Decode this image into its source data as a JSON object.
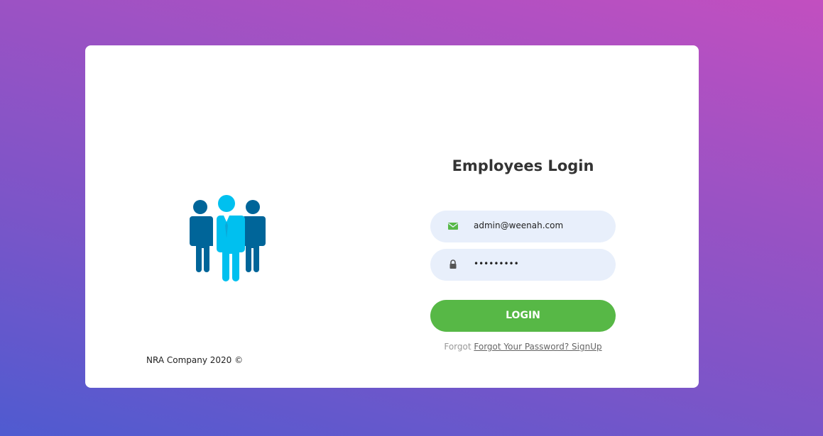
{
  "footer": {
    "copyright": "NRA Company 2020 ©"
  },
  "login": {
    "title": "Employees Login",
    "email_value": "admin@weenah.com",
    "password_value": "•••••••••",
    "button_label": "LOGIN",
    "forgot_prefix": "Forgot",
    "forgot_link": "Forgot Your Password? SignUp"
  },
  "icons": {
    "illustration": "employees-group-icon",
    "email": "envelope-icon",
    "password": "lock-icon"
  },
  "colors": {
    "accent": "#57b846",
    "input_bg": "#e8effb",
    "people_dark": "#006599",
    "people_light": "#00c0ef"
  }
}
